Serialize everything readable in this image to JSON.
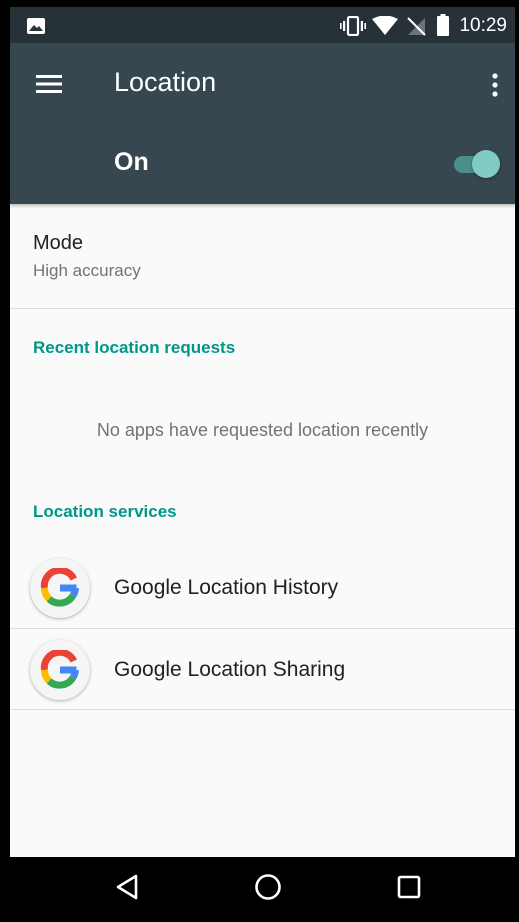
{
  "status_bar": {
    "time": "10:29",
    "icons": [
      "image-notification-icon",
      "vibrate-icon",
      "wifi-icon",
      "no-sim-icon",
      "battery-icon"
    ]
  },
  "toolbar": {
    "title": "Location",
    "menu_icon": "hamburger-menu-icon",
    "overflow_icon": "more-vert-icon"
  },
  "master_switch": {
    "label": "On",
    "checked": true,
    "accent_color": "#80cbc4"
  },
  "mode": {
    "title": "Mode",
    "summary": "High accuracy"
  },
  "recent_requests": {
    "header": "Recent location requests",
    "empty_text": "No apps have requested location recently"
  },
  "location_services": {
    "header": "Location services",
    "items": [
      {
        "label": "Google Location History",
        "icon": "google-g-icon"
      },
      {
        "label": "Google Location Sharing",
        "icon": "google-g-icon"
      }
    ]
  },
  "nav_bar": {
    "buttons": [
      "back-icon",
      "home-icon",
      "recents-icon"
    ]
  },
  "colors": {
    "toolbar": "#37474f",
    "status_bar": "#263238",
    "section_header": "#009688",
    "background": "#fafafa"
  }
}
